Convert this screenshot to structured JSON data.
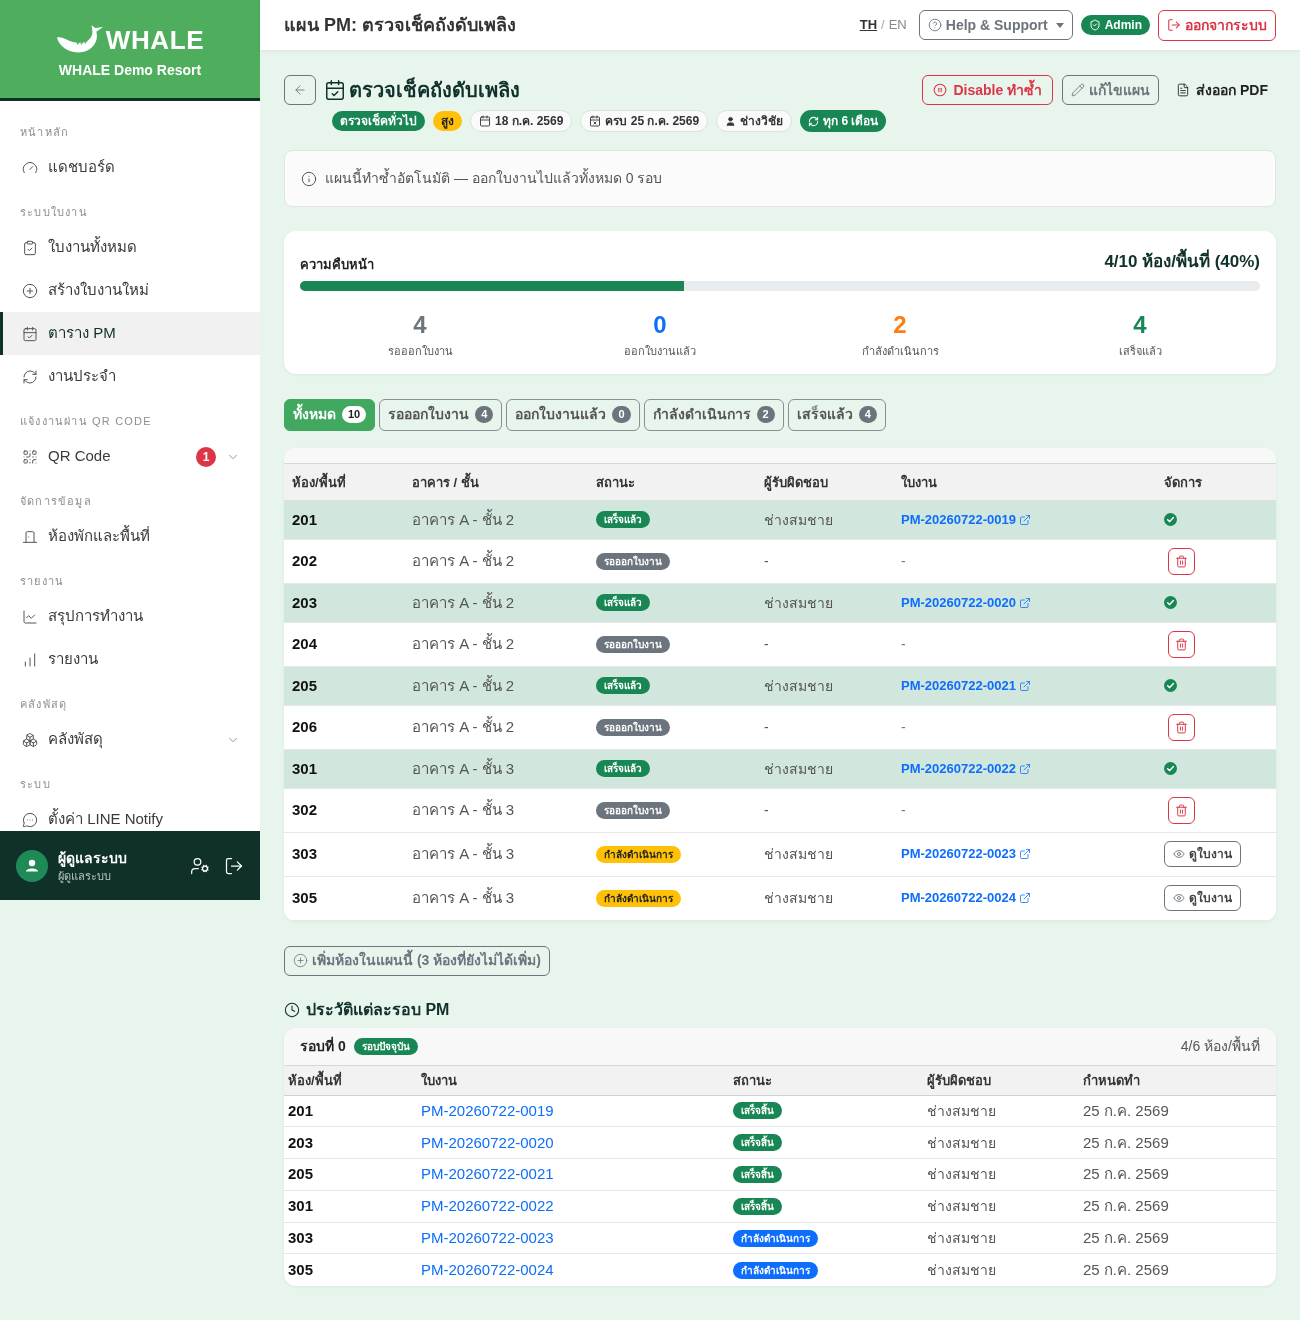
{
  "sidebar": {
    "brand": "WHALE",
    "org": "WHALE Demo Resort",
    "sections": [
      {
        "heading": "หน้าหลัก",
        "items": [
          {
            "label": "แดชบอร์ด",
            "selected": false
          }
        ]
      },
      {
        "heading": "ระบบใบงาน",
        "items": [
          {
            "label": "ใบงานทั้งหมด",
            "selected": false
          },
          {
            "label": "สร้างใบงานใหม่",
            "selected": false
          },
          {
            "label": "ตาราง PM",
            "selected": true
          },
          {
            "label": "งานประจำ",
            "selected": false
          }
        ]
      },
      {
        "heading": "แจ้งงานผ่าน QR CODE",
        "items": [
          {
            "label": "QR Code",
            "selected": false,
            "badge": "1",
            "expanded": false
          }
        ]
      },
      {
        "heading": "จัดการข้อมูล",
        "items": [
          {
            "label": "ห้องพักและพื้นที่",
            "selected": false
          }
        ]
      },
      {
        "heading": "รายงาน",
        "items": [
          {
            "label": "สรุปการทำงาน",
            "selected": false
          },
          {
            "label": "รายงาน",
            "selected": false
          }
        ]
      },
      {
        "heading": "คลังพัสดุ",
        "items": [
          {
            "label": "คลังพัสดุ",
            "selected": false,
            "expanded": false
          }
        ]
      },
      {
        "heading": "ระบบ",
        "items": [
          {
            "label": "ตั้งค่า LINE Notify",
            "selected": false
          }
        ]
      }
    ],
    "user": {
      "name": "ผู้ดูแลระบบ",
      "role": "ผู้ดูแลระบบ"
    }
  },
  "topbar": {
    "title": "แผน PM: ตรวจเช็คถังดับเพลิง",
    "languages": [
      {
        "label": "TH",
        "selected": true
      },
      {
        "label": "EN",
        "selected": false
      }
    ],
    "language_separator": "/",
    "help": "Help & Support",
    "role_badge": "Admin",
    "logout": "ออกจากระบบ"
  },
  "plan": {
    "title": "ตรวจเช็คถังดับเพลิง",
    "actions": [
      {
        "kind": "disable",
        "label": "Disable ทำซ้ำ"
      },
      {
        "kind": "edit",
        "label": "แก้ไขแผน"
      },
      {
        "kind": "export",
        "label": "ส่งออก PDF"
      }
    ],
    "tags": [
      {
        "kind": "category",
        "text": "ตรวจเช็คทั่วไป"
      },
      {
        "kind": "priority",
        "text": "สูง"
      },
      {
        "kind": "date",
        "text": "18 ก.ค. 2569"
      },
      {
        "kind": "due",
        "text": "ครบ 25 ก.ค. 2569"
      },
      {
        "kind": "assignee",
        "text": "ช่างวิชัย"
      },
      {
        "kind": "repeat",
        "text": "ทุก 6 เดือน"
      }
    ],
    "notice": "แผนนี้ทำซ้ำอัตโนมัติ — ออกใบงานไปแล้วทั้งหมด 0 รอบ"
  },
  "progress": {
    "label": "ความคืบหน้า",
    "summary": "4/10 ห้อง/พื้นที่ (40%)",
    "level": 0.4,
    "stats": [
      {
        "value": "4",
        "label": "รอออกใบงาน",
        "color": "#6c757d"
      },
      {
        "value": "0",
        "label": "ออกใบงานแล้ว",
        "color": "#0d6efd"
      },
      {
        "value": "2",
        "label": "กำลังดำเนินการ",
        "color": "#fd7e14"
      },
      {
        "value": "4",
        "label": "เสร็จแล้ว",
        "color": "#198754"
      }
    ]
  },
  "filters": [
    {
      "label": "ทั้งหมด",
      "count": "10",
      "selected": true
    },
    {
      "label": "รอออกใบงาน",
      "count": "4",
      "selected": false
    },
    {
      "label": "ออกใบงานแล้ว",
      "count": "0",
      "selected": false
    },
    {
      "label": "กำลังดำเนินการ",
      "count": "2",
      "selected": false
    },
    {
      "label": "เสร็จแล้ว",
      "count": "4",
      "selected": false
    }
  ],
  "rooms_table": {
    "columns": [
      "ห้อง/พื้นที่",
      "อาคาร / ชั้น",
      "สถานะ",
      "ผู้รับผิดชอบ",
      "ใบงาน",
      "จัดการ"
    ],
    "rows": [
      {
        "room": "201",
        "location": "อาคาร A - ชั้น 2",
        "status": {
          "kind": "done",
          "text": "เสร็จแล้ว"
        },
        "assignee": "ช่างสมชาย",
        "work_order": "PM-20260722-0019",
        "action": {
          "kind": "done"
        }
      },
      {
        "room": "202",
        "location": "อาคาร A - ชั้น 2",
        "status": {
          "kind": "pending",
          "text": "รอออกใบงาน"
        },
        "assignee": "-",
        "work_order": "-",
        "action": {
          "kind": "delete"
        }
      },
      {
        "room": "203",
        "location": "อาคาร A - ชั้น 2",
        "status": {
          "kind": "done",
          "text": "เสร็จแล้ว"
        },
        "assignee": "ช่างสมชาย",
        "work_order": "PM-20260722-0020",
        "action": {
          "kind": "done"
        }
      },
      {
        "room": "204",
        "location": "อาคาร A - ชั้น 2",
        "status": {
          "kind": "pending",
          "text": "รอออกใบงาน"
        },
        "assignee": "-",
        "work_order": "-",
        "action": {
          "kind": "delete"
        }
      },
      {
        "room": "205",
        "location": "อาคาร A - ชั้น 2",
        "status": {
          "kind": "done",
          "text": "เสร็จแล้ว"
        },
        "assignee": "ช่างสมชาย",
        "work_order": "PM-20260722-0021",
        "action": {
          "kind": "done"
        }
      },
      {
        "room": "206",
        "location": "อาคาร A - ชั้น 2",
        "status": {
          "kind": "pending",
          "text": "รอออกใบงาน"
        },
        "assignee": "-",
        "work_order": "-",
        "action": {
          "kind": "delete"
        }
      },
      {
        "room": "301",
        "location": "อาคาร A - ชั้น 3",
        "status": {
          "kind": "done",
          "text": "เสร็จแล้ว"
        },
        "assignee": "ช่างสมชาย",
        "work_order": "PM-20260722-0022",
        "action": {
          "kind": "done"
        }
      },
      {
        "room": "302",
        "location": "อาคาร A - ชั้น 3",
        "status": {
          "kind": "pending",
          "text": "รอออกใบงาน"
        },
        "assignee": "-",
        "work_order": "-",
        "action": {
          "kind": "delete"
        }
      },
      {
        "room": "303",
        "location": "อาคาร A - ชั้น 3",
        "status": {
          "kind": "in_progress",
          "text": "กำลังดำเนินการ"
        },
        "assignee": "ช่างสมชาย",
        "work_order": "PM-20260722-0023",
        "action": {
          "kind": "view",
          "label": "ดูใบงาน"
        }
      },
      {
        "room": "305",
        "location": "อาคาร A - ชั้น 3",
        "status": {
          "kind": "in_progress",
          "text": "กำลังดำเนินการ"
        },
        "assignee": "ช่างสมชาย",
        "work_order": "PM-20260722-0024",
        "action": {
          "kind": "view",
          "label": "ดูใบงาน"
        }
      }
    ]
  },
  "add_rooms_button": "เพิ่มห้องในแผนนี้ (3 ห้องที่ยังไม่ได้เพิ่ม)",
  "history": {
    "title": "ประวัติแต่ละรอบ PM",
    "rounds": [
      {
        "label": "รอบที่ 0",
        "badge": "รอบปัจจุบัน",
        "summary": "4/6 ห้อง/พื้นที่",
        "columns": [
          "ห้อง/พื้นที่",
          "ใบงาน",
          "สถานะ",
          "ผู้รับผิดชอบ",
          "กำหนดทำ"
        ],
        "rows": [
          {
            "room": "201",
            "work_order": "PM-20260722-0019",
            "status": {
              "kind": "completed",
              "text": "เสร็จสิ้น"
            },
            "assignee": "ช่างสมชาย",
            "due": "25 ก.ค. 2569"
          },
          {
            "room": "203",
            "work_order": "PM-20260722-0020",
            "status": {
              "kind": "completed",
              "text": "เสร็จสิ้น"
            },
            "assignee": "ช่างสมชาย",
            "due": "25 ก.ค. 2569"
          },
          {
            "room": "205",
            "work_order": "PM-20260722-0021",
            "status": {
              "kind": "completed",
              "text": "เสร็จสิ้น"
            },
            "assignee": "ช่างสมชาย",
            "due": "25 ก.ค. 2569"
          },
          {
            "room": "301",
            "work_order": "PM-20260722-0022",
            "status": {
              "kind": "completed",
              "text": "เสร็จสิ้น"
            },
            "assignee": "ช่างสมชาย",
            "due": "25 ก.ค. 2569"
          },
          {
            "room": "303",
            "work_order": "PM-20260722-0023",
            "status": {
              "kind": "in_progress",
              "text": "กำลังดำเนินการ"
            },
            "assignee": "ช่างสมชาย",
            "due": "25 ก.ค. 2569"
          },
          {
            "room": "305",
            "work_order": "PM-20260722-0024",
            "status": {
              "kind": "in_progress",
              "text": "กำลังดำเนินการ"
            },
            "assignee": "ช่างสมชาย",
            "due": "25 ก.ค. 2569"
          }
        ]
      }
    ]
  }
}
